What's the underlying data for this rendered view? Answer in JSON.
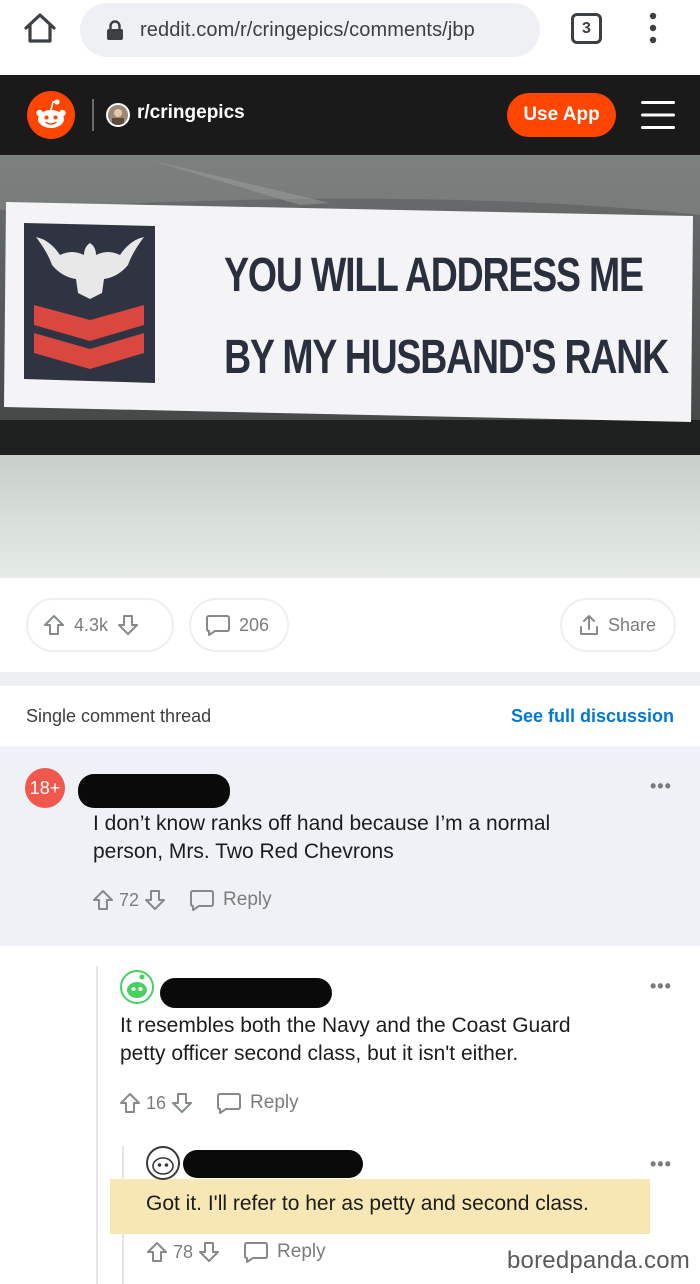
{
  "browser": {
    "url": "reddit.com/r/cringepics/comments/jbp",
    "tab_count": "3"
  },
  "header": {
    "subreddit": "r/cringepics",
    "use_app_label": "Use App"
  },
  "post": {
    "sticker_line1": "YOU WILL ADDRESS ME",
    "sticker_line2": "BY MY HUSBAND'S RANK",
    "score": "4.3k",
    "comment_count": "206",
    "share_label": "Share"
  },
  "thread": {
    "label": "Single comment thread",
    "see_full_label": "See full discussion"
  },
  "comments": [
    {
      "avatar_badge": "18+",
      "body_line1": "I don’t know ranks off hand because I’m a normal",
      "body_line2": "person, Mrs. Two Red Chevrons",
      "score": "72",
      "reply_label": "Reply"
    },
    {
      "body_line1": "It resembles both the Navy and the Coast Guard",
      "body_line2": "petty officer second class, but it isn't either.",
      "score": "16",
      "reply_label": "Reply"
    },
    {
      "body": "Got it. I'll refer to her as petty and second class.",
      "score": "78",
      "reply_label": "Reply"
    }
  ],
  "watermark": "boredpanda.com",
  "colors": {
    "reddit_orange": "#ff4500",
    "link_blue": "#0079d3",
    "highlight": "#f7e7b5",
    "chevron_red": "#d9473f"
  }
}
